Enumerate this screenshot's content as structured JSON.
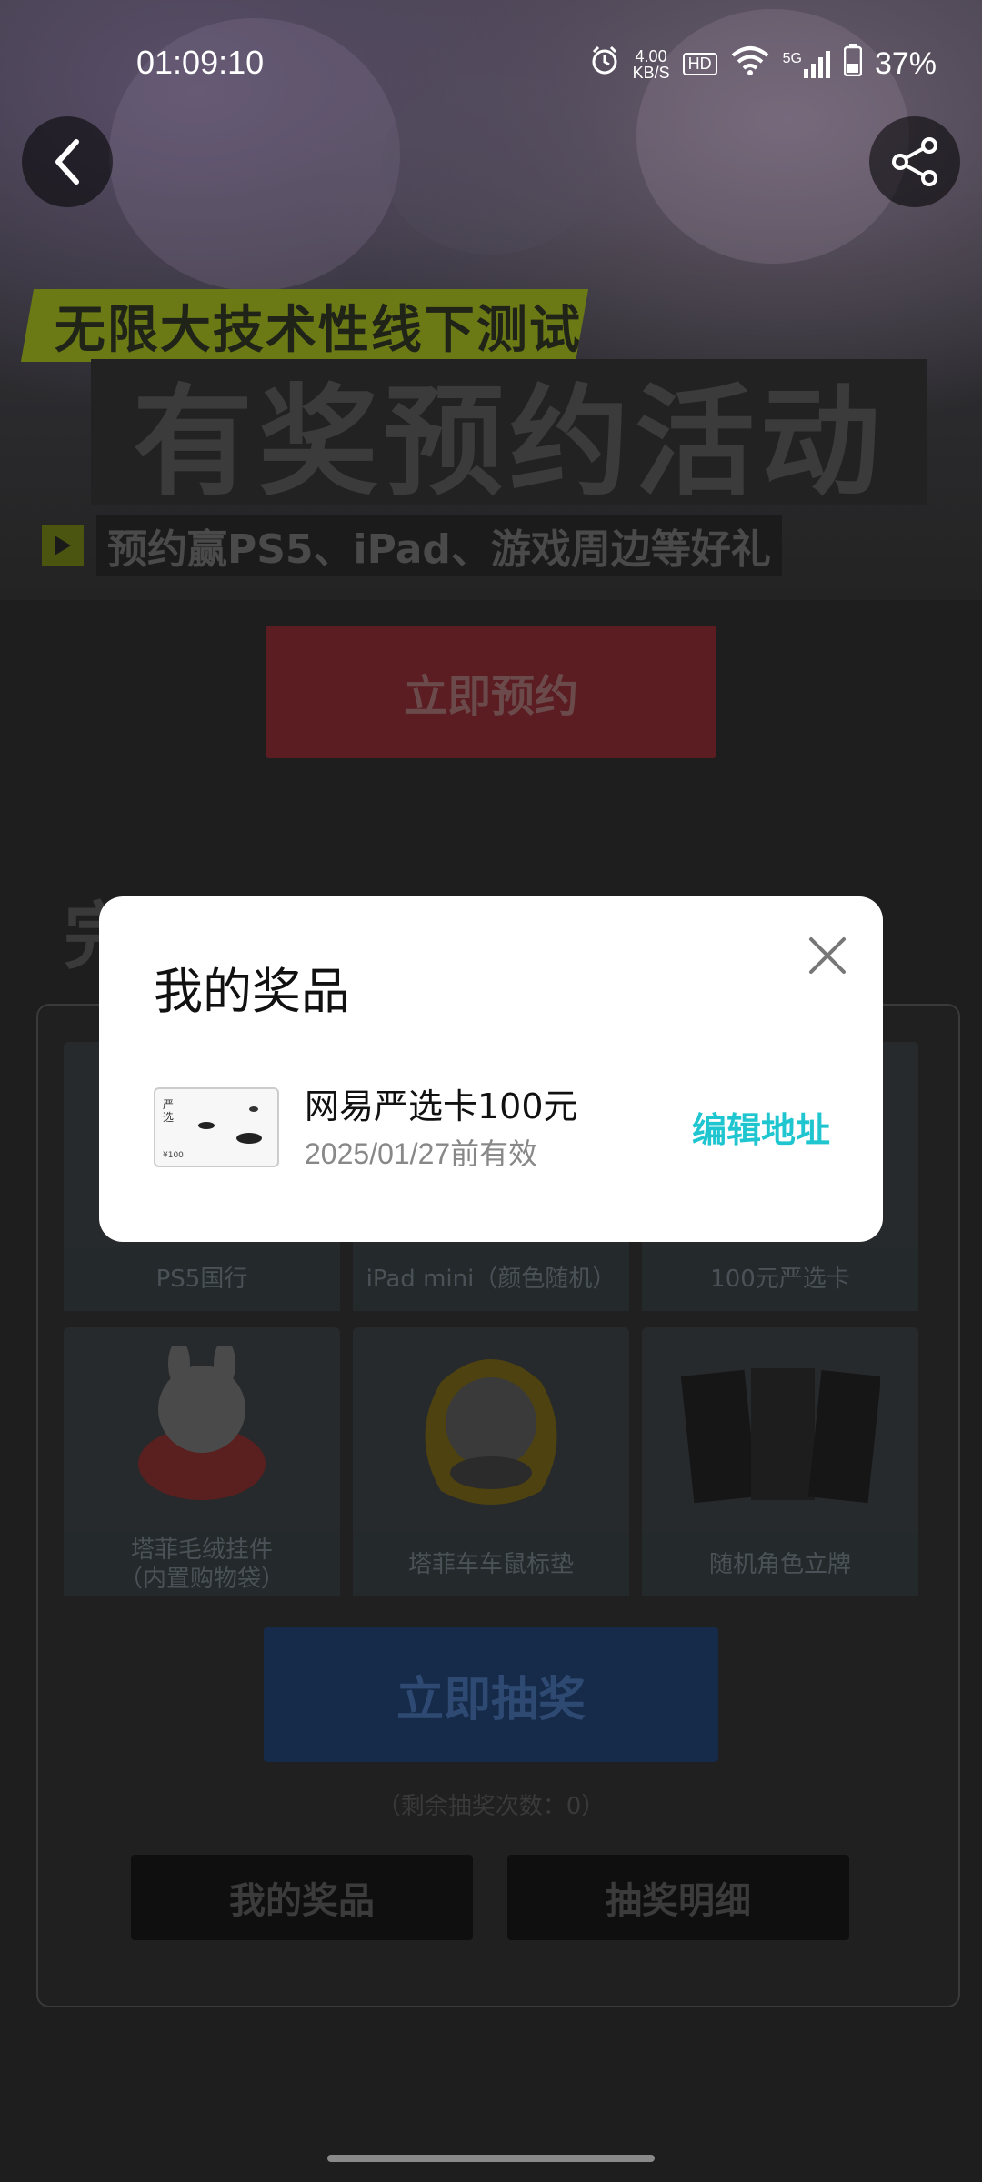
{
  "status_bar": {
    "time": "01:09:10",
    "speed_value": "4.00",
    "speed_unit": "KB/S",
    "hd": "HD",
    "network": "5G",
    "battery": "37%"
  },
  "hero": {
    "subtitle": "无限大技术性线下测试",
    "title": "有奖预约活动",
    "description": "预约赢PS5、iPad、游戏周边等好礼",
    "reserve_button": "立即预约"
  },
  "lottery": {
    "section_title": "完成任务 赢好礼",
    "prizes": [
      {
        "label": "PS5国行"
      },
      {
        "label": "iPad mini（颜色随机）"
      },
      {
        "label": "100元严选卡"
      },
      {
        "label": "塔菲毛绒挂件\n（内置购物袋）"
      },
      {
        "label": "塔菲车车鼠标垫"
      },
      {
        "label": "随机角色立牌"
      }
    ],
    "draw_button": "立即抽奖",
    "remaining": "（剩余抽奖次数：0）",
    "my_prizes_button": "我的奖品",
    "detail_button": "抽奖明细"
  },
  "modal": {
    "title": "我的奖品",
    "prize_name": "网易严选卡100元",
    "prize_expire": "2025/01/27前有效",
    "edit_address": "编辑地址",
    "thumb_text_1": "严",
    "thumb_text_2": "选",
    "thumb_value": "¥100"
  },
  "colors": {
    "accent": "#1fc5cf",
    "modal_bg": "#ffffff"
  }
}
